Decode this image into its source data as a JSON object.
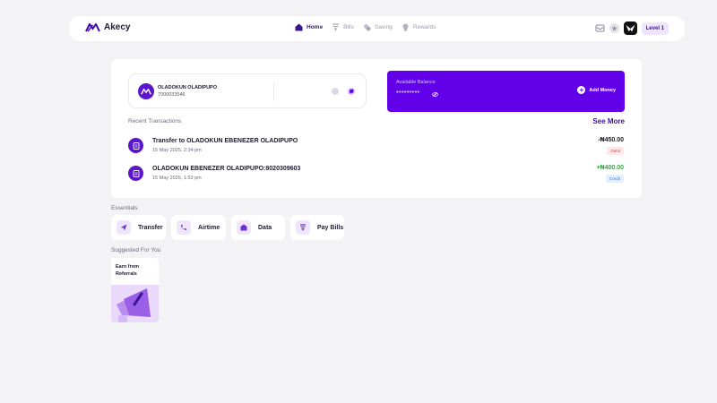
{
  "nav": {
    "brand": "Akecy",
    "items": [
      {
        "label": "Home",
        "icon": "home-icon",
        "active": true
      },
      {
        "label": "Bills",
        "icon": "bills-icon",
        "active": false
      },
      {
        "label": "Saving",
        "icon": "saving-icon",
        "active": false
      },
      {
        "label": "Rewards",
        "icon": "rewards-icon",
        "active": false
      }
    ],
    "level": "Level 1"
  },
  "account": {
    "name": "OLADOKUN OLADIPUPO",
    "number": "7000033546"
  },
  "balance": {
    "label": "Available Balance",
    "masked": "*********",
    "add_money": "Add Money"
  },
  "recent": {
    "title": "Recent Transactions",
    "see_more": "See More",
    "transactions": [
      {
        "title": "Transfer to OLADOKUN EBENEZER OLADIPUPO",
        "date": "15 May 2025, 2:34 pm",
        "amount": "-₦450.00",
        "type": "Debit"
      },
      {
        "title": "OLADOKUN EBENEZER OLADIPUPO:8020309603",
        "date": "15 May 2025, 1:53 pm",
        "amount": "+₦400.00",
        "type": "Credit"
      }
    ]
  },
  "essentials": {
    "title": "Essentials",
    "items": [
      {
        "label": "Transfer",
        "icon": "send-icon"
      },
      {
        "label": "Airtime",
        "icon": "phone-icon"
      },
      {
        "label": "Data",
        "icon": "data-icon"
      },
      {
        "label": "Pay Bills",
        "icon": "bills-icon"
      }
    ]
  },
  "suggested": {
    "title": "Suggested For You",
    "card": "Earn from Referrals"
  },
  "colors": {
    "primary": "#6200ea",
    "accent_dark": "#3b1396",
    "debit": "#e04a4a",
    "credit": "#2eaa3f"
  }
}
